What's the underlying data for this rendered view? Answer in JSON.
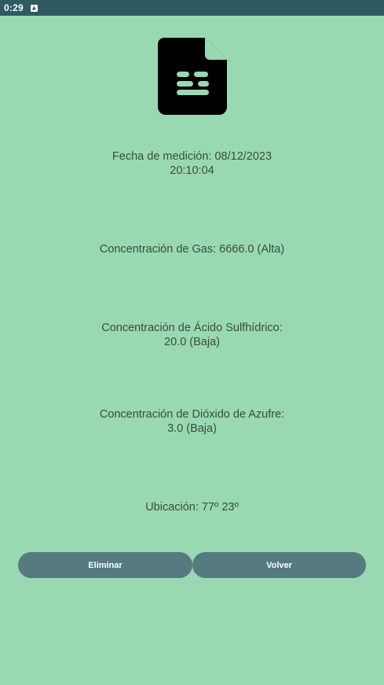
{
  "status_bar": {
    "time": "0:29",
    "notification_icon": "app-notification-icon"
  },
  "header": {
    "icon": "document-icon"
  },
  "fields": {
    "fecha": {
      "line1": "Fecha de medición: 08/12/2023",
      "line2": "20:10:04"
    },
    "gas": {
      "line1": "Concentración de Gas: 6666.0 (Alta)"
    },
    "acido": {
      "line1": "Concentración de Ácido Sulfhídrico:",
      "line2": "20.0 (Baja)"
    },
    "dioxido": {
      "line1": "Concentración de Dióxido de Azufre:",
      "line2": "3.0 (Baja)"
    },
    "ubicacion": {
      "line1": "Ubicación: 77º 23º"
    }
  },
  "buttons": {
    "delete_label": "Eliminar",
    "back_label": "Volver"
  },
  "colors": {
    "background": "#99d9b1",
    "status_bar": "#2f5a63",
    "button": "#557a80",
    "text": "#3a4a44"
  }
}
